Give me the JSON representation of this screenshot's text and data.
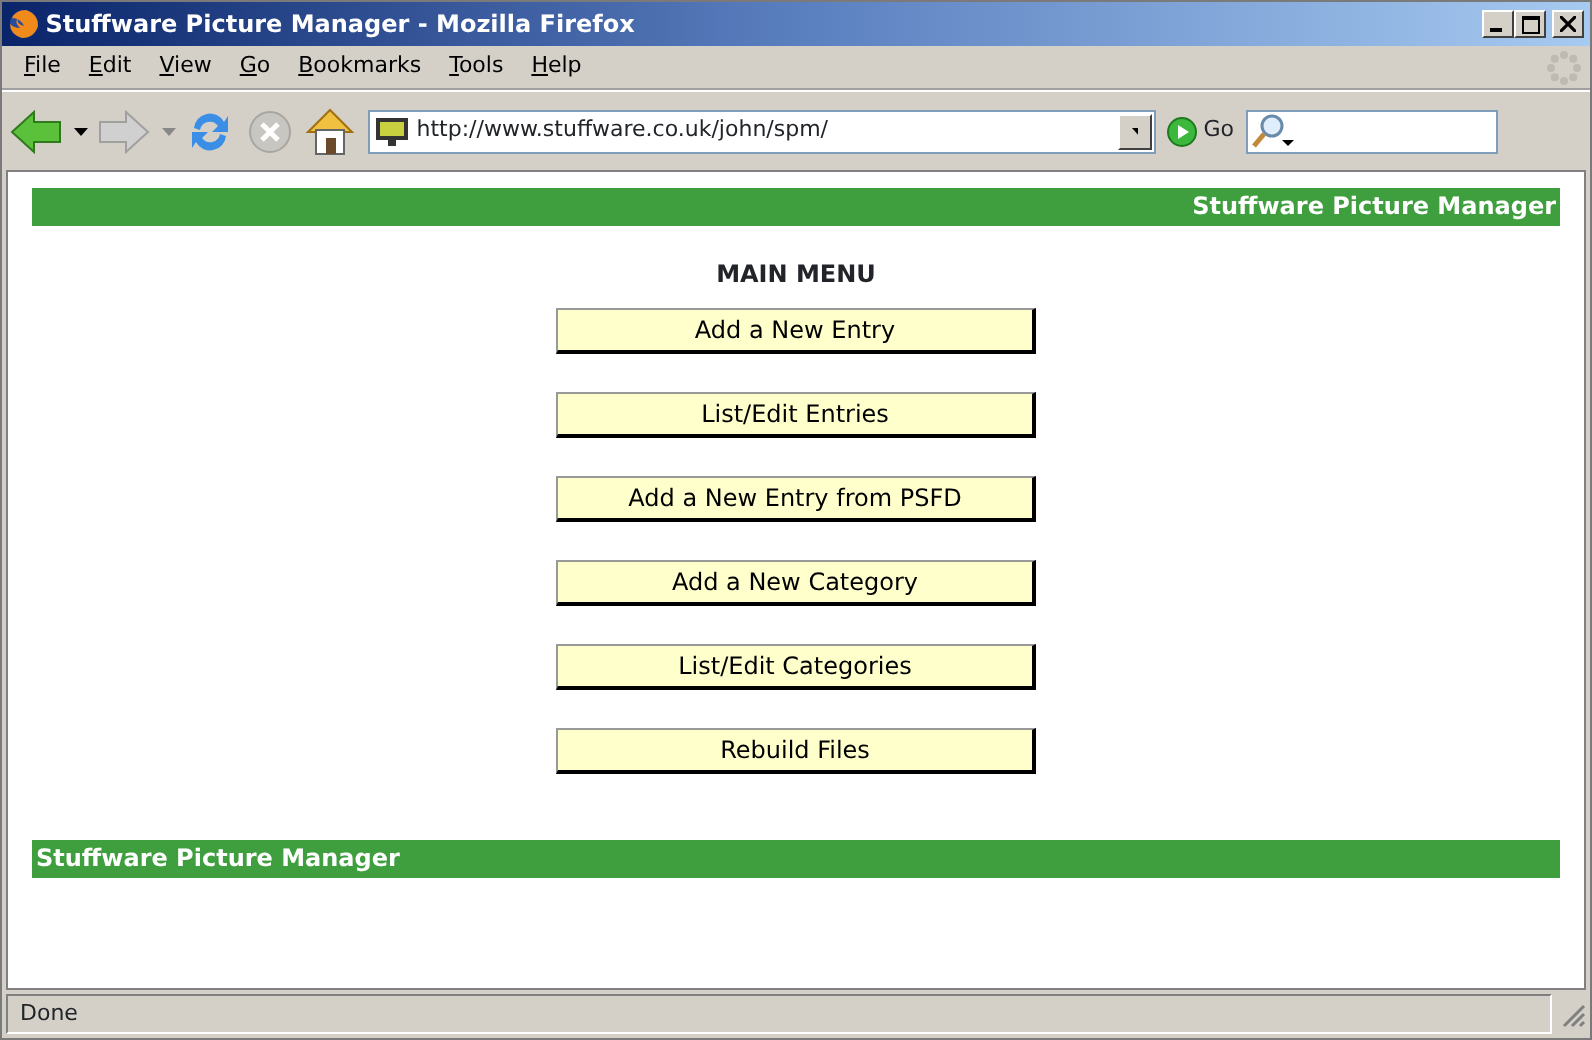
{
  "window": {
    "title": "Stuffware Picture Manager - Mozilla Firefox"
  },
  "menu": [
    "File",
    "Edit",
    "View",
    "Go",
    "Bookmarks",
    "Tools",
    "Help"
  ],
  "toolbar": {
    "address": "http://www.stuffware.co.uk/john/spm/",
    "go_label": "Go"
  },
  "page": {
    "header": "Stuffware Picture Manager",
    "heading": "MAIN MENU",
    "buttons": [
      "Add a New Entry",
      "List/Edit Entries",
      "Add a New Entry from PSFD",
      "Add a New Category",
      "List/Edit Categories",
      "Rebuild Files"
    ],
    "footer": "Stuffware Picture Manager"
  },
  "status_bar": "Done"
}
